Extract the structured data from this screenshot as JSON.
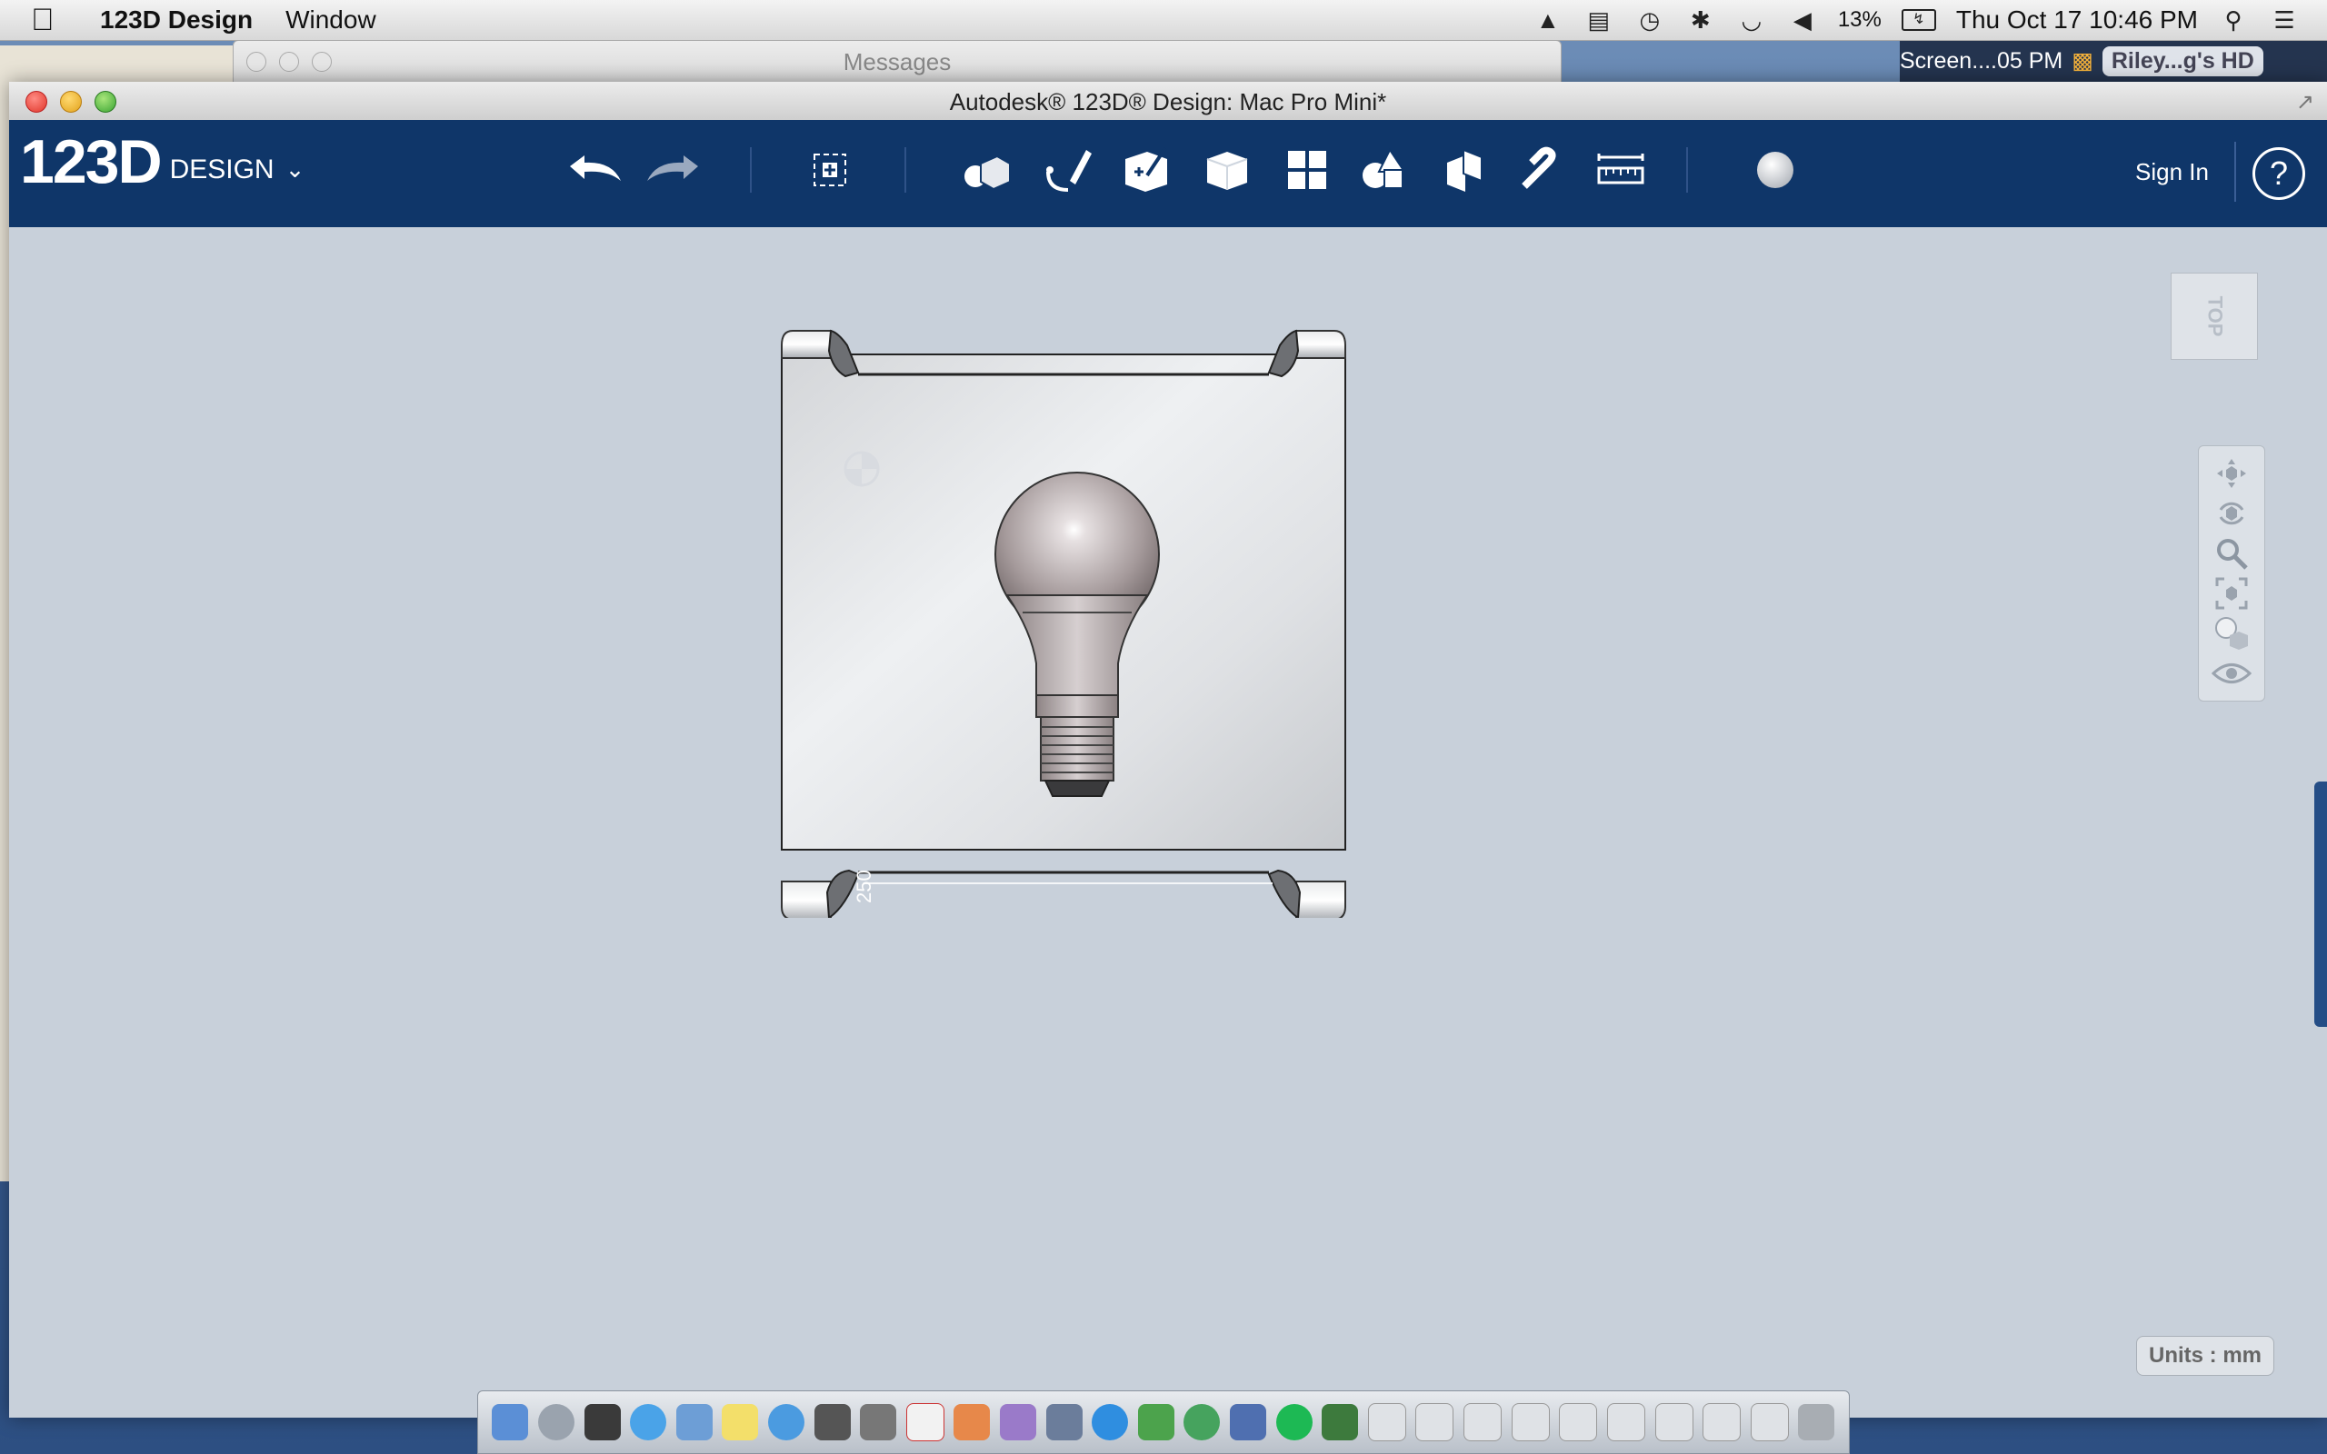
{
  "menubar": {
    "app_name": "123D Design",
    "menu_window": "Window",
    "battery": "13%",
    "datetime": "Thu Oct 17  10:46 PM"
  },
  "messages_window": {
    "title": "Messages"
  },
  "finder": {
    "item": "Screen....05 PM",
    "disk": "Riley...g's HD"
  },
  "window": {
    "title": "Autodesk® 123D® Design: Mac Pro Mini*"
  },
  "app": {
    "brand_num": "123D",
    "brand_word": "DESIGN",
    "sign_in": "Sign In",
    "help": "?"
  },
  "viewport": {
    "view_cube_label": "TOP",
    "grid_label": "250",
    "units_label": "Units : mm"
  },
  "icons": [
    "apple-icon",
    "undo-icon",
    "redo-icon",
    "transform-icon",
    "primitives-icon",
    "sketch-icon",
    "construct-icon",
    "modify-icon",
    "pattern-icon",
    "group-icon",
    "combine-icon",
    "measure-icon",
    "snap-icon",
    "material-icon",
    "pan-icon",
    "orbit-icon",
    "zoom-icon",
    "fit-icon",
    "visual-style-icon",
    "visibility-icon"
  ]
}
